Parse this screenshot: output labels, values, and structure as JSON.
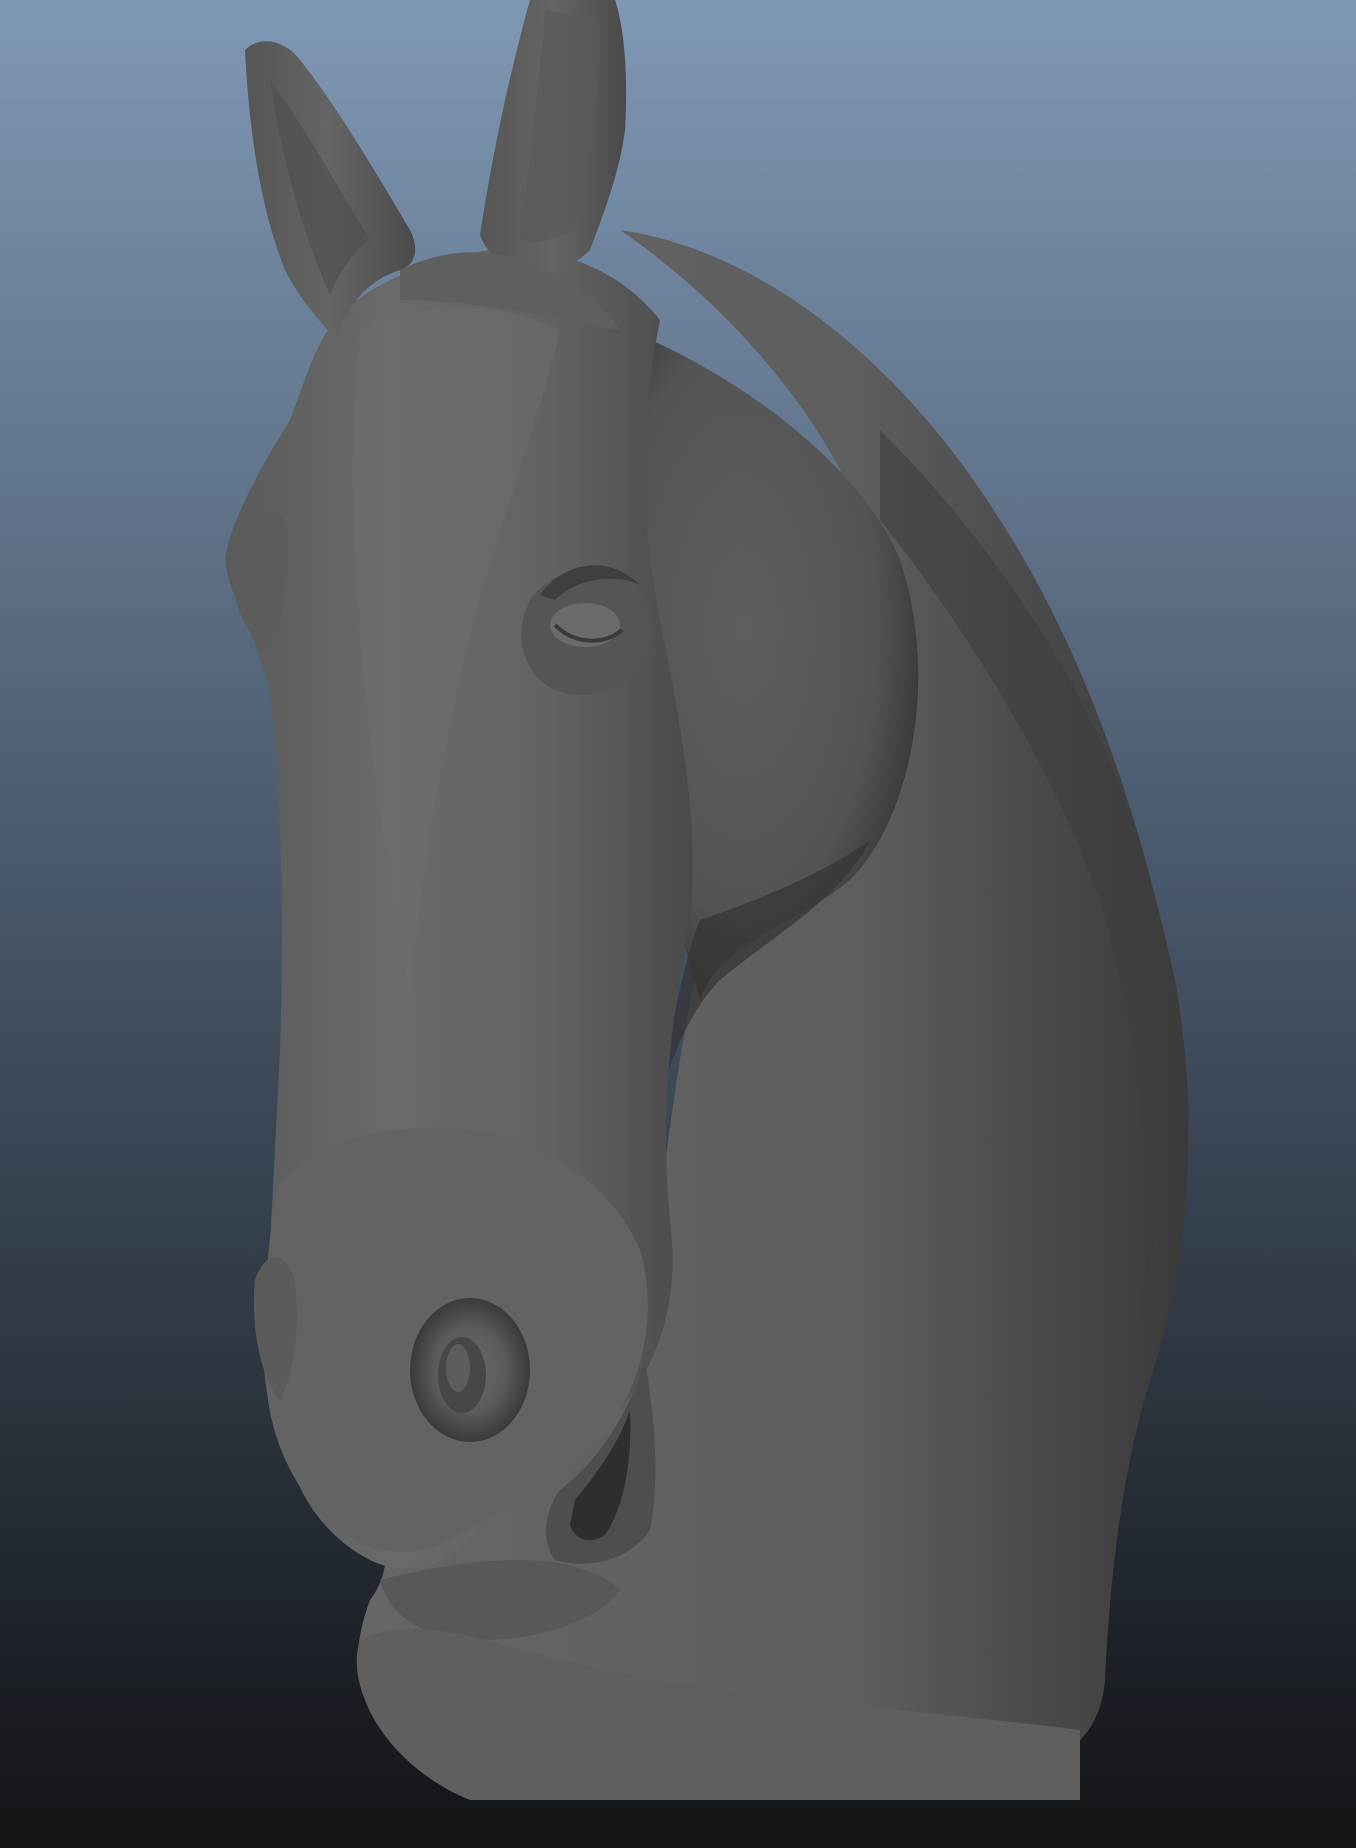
{
  "viewport": {
    "kind": "3d-viewport",
    "background": {
      "top_color": "#7f98b5",
      "mid_color": "#4b5b6e",
      "bottom_color": "#121417"
    }
  },
  "model": {
    "subject": "horse-head-sculpt",
    "shading": "smooth-grey",
    "colors": {
      "base": "#606060",
      "highlight": "#707070",
      "shadow": "#3c3c3c",
      "deep_shadow": "#2a2a2a"
    }
  }
}
